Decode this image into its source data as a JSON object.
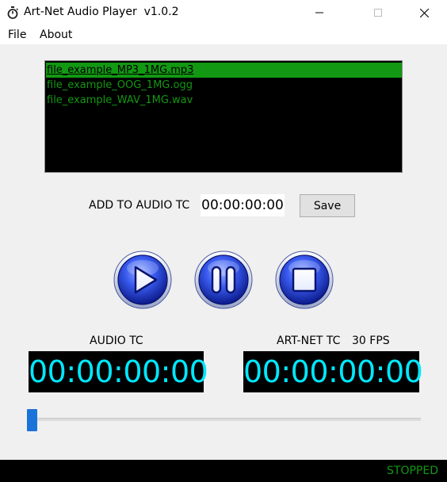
{
  "window": {
    "title": "Art-Net Audio Player  v1.0.2",
    "icon": "stopwatch-icon",
    "controls": [
      "minimize-icon",
      "maximize-icon",
      "close-icon"
    ]
  },
  "menu": {
    "file": "File",
    "about": "About"
  },
  "playlist": {
    "items": [
      "file_example_MP3_1MG.mp3",
      "file_example_OOG_1MG.ogg",
      "file_example_WAV_1MG.wav"
    ],
    "selected_index": 0
  },
  "add_tc": {
    "label": "ADD TO AUDIO TC",
    "value": "00:00:00:00",
    "save_label": "Save"
  },
  "transport": {
    "play": "play-icon",
    "pause": "pause-icon",
    "stop": "stop-icon"
  },
  "audio_tc": {
    "label": "AUDIO TC",
    "value": "00:00:00:00"
  },
  "artnet_tc": {
    "label": "ART-NET TC",
    "fps": "30 FPS",
    "value": "00:00:00:00"
  },
  "position_slider": {
    "value": 0
  },
  "status": {
    "text": "STOPPED"
  },
  "colors": {
    "accent_green": "#129812",
    "tc_cyan": "#00e8ff",
    "button_blue": "#1f3fd0",
    "slider_blue": "#1a73d9"
  }
}
